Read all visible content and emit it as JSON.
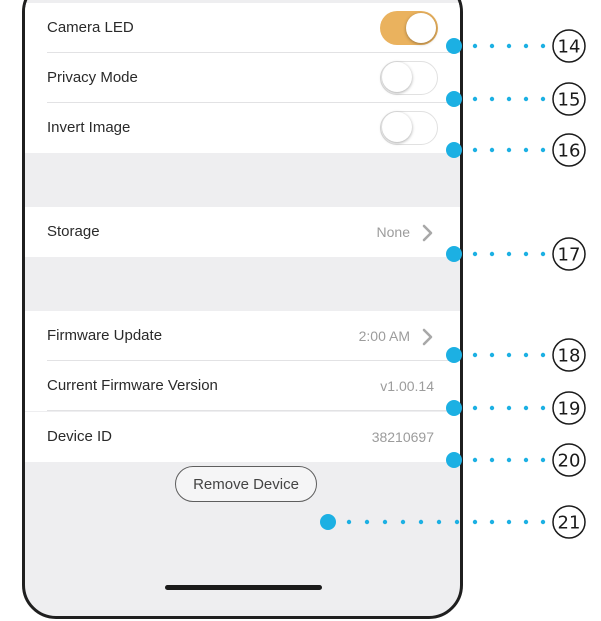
{
  "settings": {
    "camera_led": {
      "label": "Camera LED",
      "on": true
    },
    "privacy_mode": {
      "label": "Privacy Mode",
      "on": false
    },
    "invert_image": {
      "label": "Invert Image",
      "on": false
    },
    "storage": {
      "label": "Storage",
      "value": "None"
    },
    "firmware_update": {
      "label": "Firmware Update",
      "value": "2:00 AM"
    },
    "firmware_version": {
      "label": "Current Firmware Version",
      "value": "v1.00.14"
    },
    "device_id": {
      "label": "Device ID",
      "value": "38210697"
    }
  },
  "remove_device": {
    "label": "Remove Device"
  },
  "callouts": [
    "14",
    "15",
    "16",
    "17",
    "18",
    "19",
    "20",
    "21"
  ],
  "colors": {
    "toggle_on": "#eab25e",
    "callout": "#1cb0e3",
    "background": "#eeeef0"
  },
  "icons": {
    "chevron": "chevron-right-icon"
  }
}
